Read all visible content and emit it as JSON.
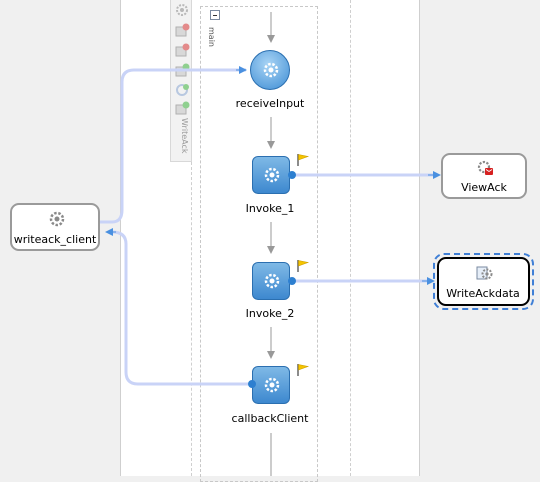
{
  "scope": {
    "label": "main",
    "palette_label": "WriteAck"
  },
  "activities": {
    "receive": "receiveInput",
    "invoke1": "Invoke_1",
    "invoke2": "Invoke_2",
    "callback": "callbackClient"
  },
  "partner_links": {
    "client": "writeack_client",
    "view": "ViewAck",
    "write": "WriteAckdata"
  },
  "icons": {
    "activity": "gear-icon",
    "flag": "flag-icon",
    "service": "service-icon"
  },
  "colors": {
    "activity_blue": "#3d88cf",
    "wire": "#c9d3f7",
    "flow_arrow": "#999999",
    "selection": "#3f7fd6",
    "flag": "#f5c400"
  }
}
